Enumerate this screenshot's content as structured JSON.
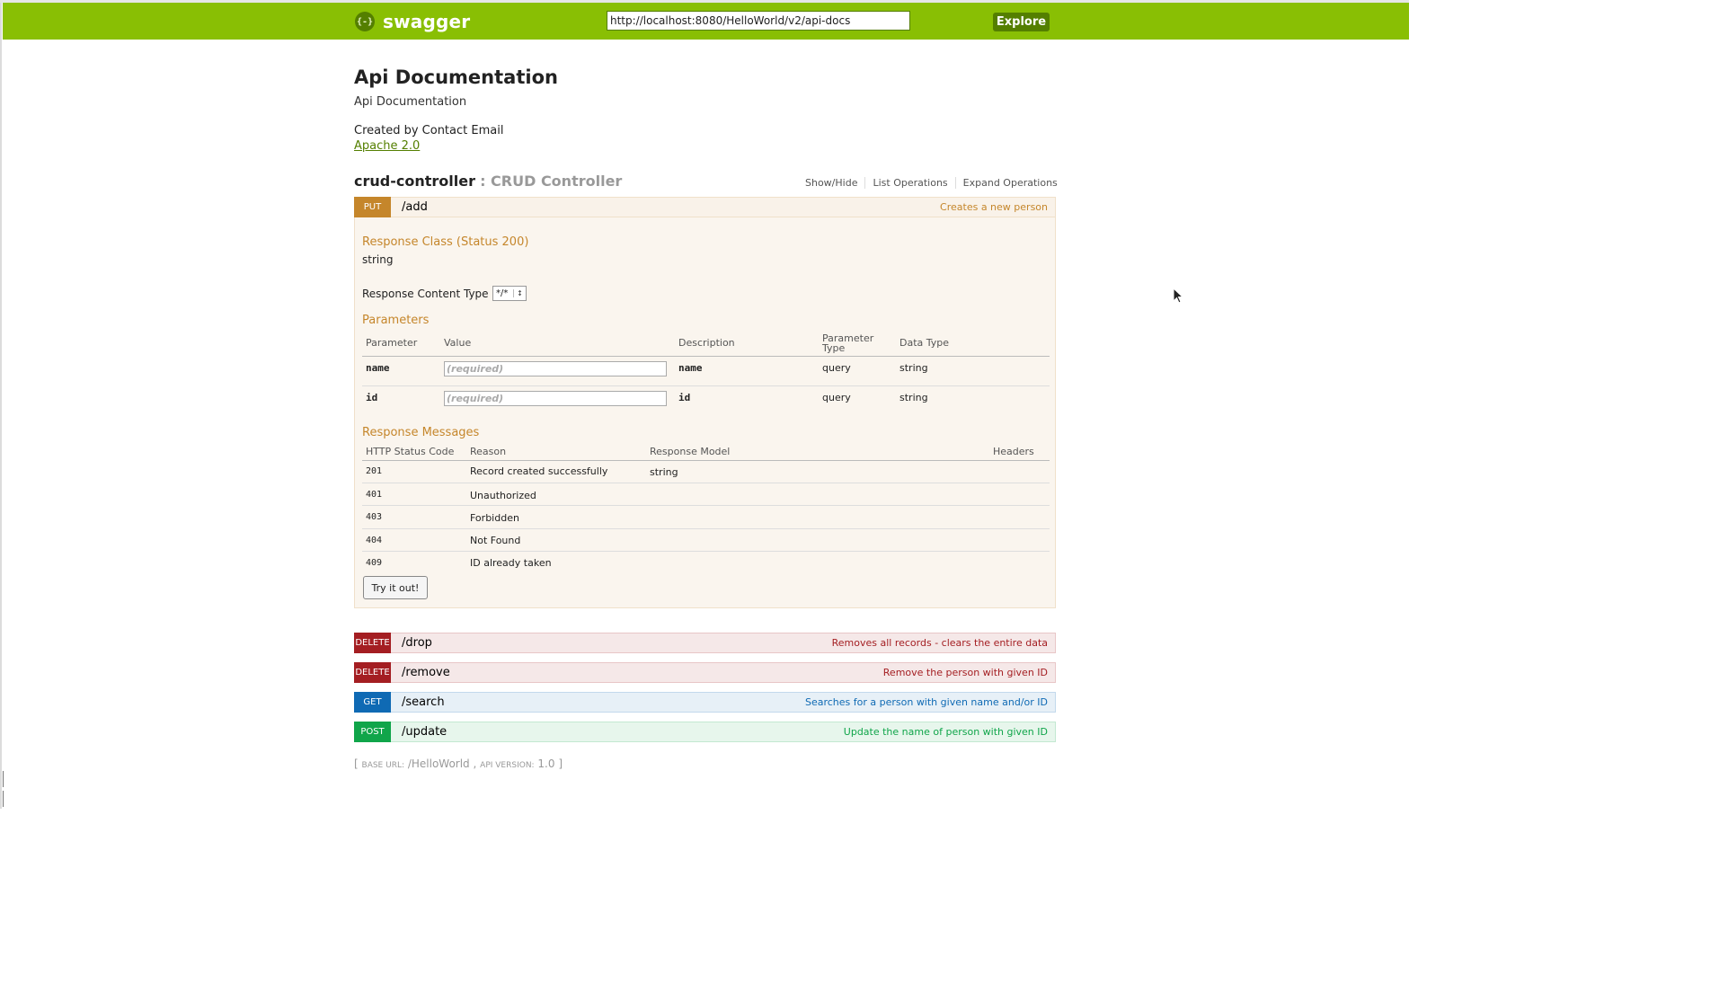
{
  "header": {
    "logo_symbol": "{-}",
    "logo_text": "swagger",
    "url_value": "http://localhost:8080/HelloWorld/v2/api-docs",
    "explore_label": "Explore",
    "brand_color": "#89bf04"
  },
  "info": {
    "title": "Api Documentation",
    "description": "Api Documentation",
    "created_by": "Created by Contact Email",
    "license": "Apache 2.0"
  },
  "resource": {
    "name": "crud-controller",
    "description": ": CRUD Controller",
    "options": [
      "Show/Hide",
      "List Operations",
      "Expand Operations"
    ]
  },
  "operations": [
    {
      "method": "PUT",
      "path": "/add",
      "summary": "Creates a new person",
      "color": "#c5862b"
    },
    {
      "method": "DELETE",
      "path": "/drop",
      "summary": "Removes all records - clears the entire data",
      "color": "#a41e22"
    },
    {
      "method": "DELETE",
      "path": "/remove",
      "summary": "Remove the person with given ID",
      "color": "#a41e22"
    },
    {
      "method": "GET",
      "path": "/search",
      "summary": "Searches for a person with given name and/or ID",
      "color": "#0f6ab4"
    },
    {
      "method": "POST",
      "path": "/update",
      "summary": "Update the name of person with given ID",
      "color": "#10a54a"
    }
  ],
  "expanded": {
    "response_class_heading": "Response Class (Status 200)",
    "response_class": "string",
    "content_type_label": "Response Content Type",
    "content_type_value": "*/*",
    "parameters_heading": "Parameters",
    "param_headers": [
      "Parameter",
      "Value",
      "Description",
      "Parameter Type",
      "Data Type"
    ],
    "params": [
      {
        "name": "name",
        "placeholder": "(required)",
        "description": "name",
        "type": "query",
        "data_type": "string"
      },
      {
        "name": "id",
        "placeholder": "(required)",
        "description": "id",
        "type": "query",
        "data_type": "string"
      }
    ],
    "messages_heading": "Response Messages",
    "message_headers": [
      "HTTP Status Code",
      "Reason",
      "Response Model",
      "Headers"
    ],
    "messages": [
      {
        "code": "201",
        "reason": "Record created successfully",
        "model": "string"
      },
      {
        "code": "401",
        "reason": "Unauthorized",
        "model": ""
      },
      {
        "code": "403",
        "reason": "Forbidden",
        "model": ""
      },
      {
        "code": "404",
        "reason": "Not Found",
        "model": ""
      },
      {
        "code": "409",
        "reason": "ID already taken",
        "model": ""
      }
    ],
    "try_label": "Try it out!"
  },
  "footer": {
    "open": "[",
    "base_url_label": "base url:",
    "base_url": "/HelloWorld",
    "separator": ",",
    "version_label": "api version:",
    "version": "1.0",
    "close": "]"
  }
}
